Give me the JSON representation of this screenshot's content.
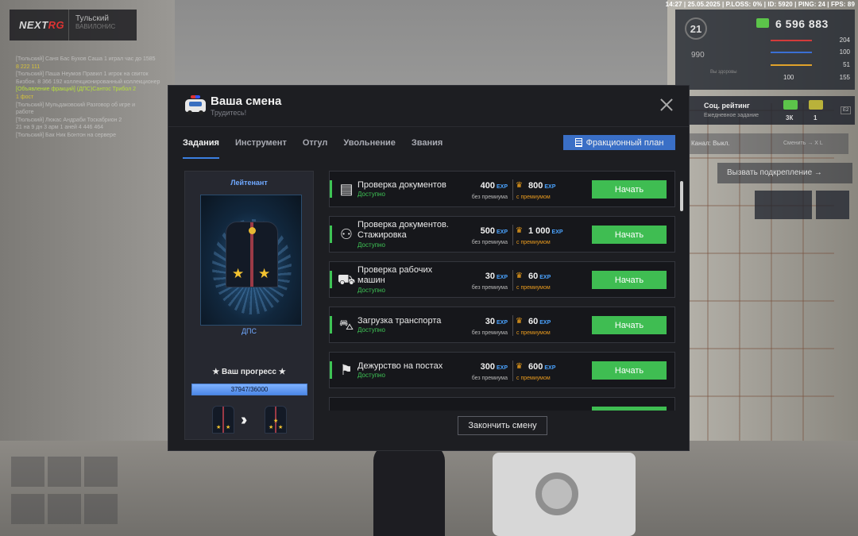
{
  "status_bar": "14:27 | 25.05.2025 | P.LOSS: 0% | ID: 5920 | PING: 24 | FPS: 89",
  "logo": {
    "part1": "NEXT",
    "part2": "RG"
  },
  "server": {
    "name": "Тульский",
    "sub": "ВАВИЛОНИС"
  },
  "chat": [
    {
      "text": "[Тюльский] Саня Бас Бухов Саша 1 играл час до 1585",
      "style": "dim"
    },
    {
      "text": "8 222 111",
      "style": "hl"
    },
    {
      "text": "[Тюльский] Паша Неумов Правил 1 игрок на свиток",
      "style": "dim"
    },
    {
      "text": "Бизбон. 8 366 192 коллекционированный коллекционер",
      "style": "dim"
    },
    {
      "text": "[Объявление фракций] (ДПС)Сантос Трибол 2",
      "style": "g"
    },
    {
      "text": "1 фост",
      "style": "hl"
    },
    {
      "text": "[Тюльский] Мульдаковский Разговор об игре и",
      "style": "dim"
    },
    {
      "text": "работе",
      "style": "dim"
    },
    {
      "text": "[Тюльский] Люкас Андраби Тоскабрион 2",
      "style": "dim"
    },
    {
      "text": "21 на 9 дн 3 арм 1 аней  4 446 464",
      "style": "dim"
    },
    {
      "text": "[Тюльский] Бак Ник Бонтон на сервере",
      "style": "dim"
    }
  ],
  "hud": {
    "level": "21",
    "money": "6 596 883",
    "sub_value": "990",
    "sub_label": "Вы здоровы",
    "stats": [
      {
        "value": "204",
        "color": "#d33b3b"
      },
      {
        "value": "100",
        "color": "#3b6fd3"
      },
      {
        "value": "51",
        "color": "#e0a22b"
      },
      {
        "value": "155",
        "color": "#aaaaaa"
      }
    ],
    "armor_value": "100"
  },
  "rating": {
    "title": "Соц. рейтинг",
    "sub": "Ежедневное задание",
    "val1": "3К",
    "val2": "1",
    "key": "E2"
  },
  "channel": {
    "label": "Канал: Выкл.",
    "switch": "Сменить → X  L"
  },
  "backup": "Вызвать подкрепление →",
  "modal": {
    "title": "Ваша смена",
    "subtitle": "Трудитесь!",
    "tabs": [
      {
        "label": "Задания",
        "active": true
      },
      {
        "label": "Инструмент",
        "active": false
      },
      {
        "label": "Отгул",
        "active": false
      },
      {
        "label": "Увольнение",
        "active": false
      },
      {
        "label": "Звания",
        "active": false
      }
    ],
    "plan_button": "Фракционный план",
    "rank": {
      "name": "Лейтенант",
      "department": "ДПС",
      "progress_label": "★ Ваш прогресс ★",
      "progress_text": "37947/36000",
      "progress_fraction": 1.0
    },
    "exp_tag": "EXP",
    "base_label": "без премиума",
    "premium_label": "с премиумом",
    "start_label": "Начать",
    "tasks": [
      {
        "name": "Проверка документов",
        "status": "Доступно",
        "base": "400",
        "premium": "800",
        "icon": "passport-icon",
        "glyph": "▤"
      },
      {
        "name": "Проверка документов. Стажировка",
        "status": "Доступно",
        "base": "500",
        "premium": "1 000",
        "icon": "officers-icon",
        "glyph": "⚇"
      },
      {
        "name": "Проверка рабочих машин",
        "status": "Доступно",
        "base": "30",
        "premium": "60",
        "icon": "police-car-icon",
        "glyph": "⛟"
      },
      {
        "name": "Загрузка транспорта",
        "status": "Доступно",
        "base": "30",
        "premium": "60",
        "icon": "tow-truck-icon",
        "glyph": "⛍"
      },
      {
        "name": "Дежурство на постах",
        "status": "Доступно",
        "base": "300",
        "premium": "600",
        "icon": "post-duty-icon",
        "glyph": "⚑"
      }
    ],
    "finish_button": "Закончить смену"
  }
}
